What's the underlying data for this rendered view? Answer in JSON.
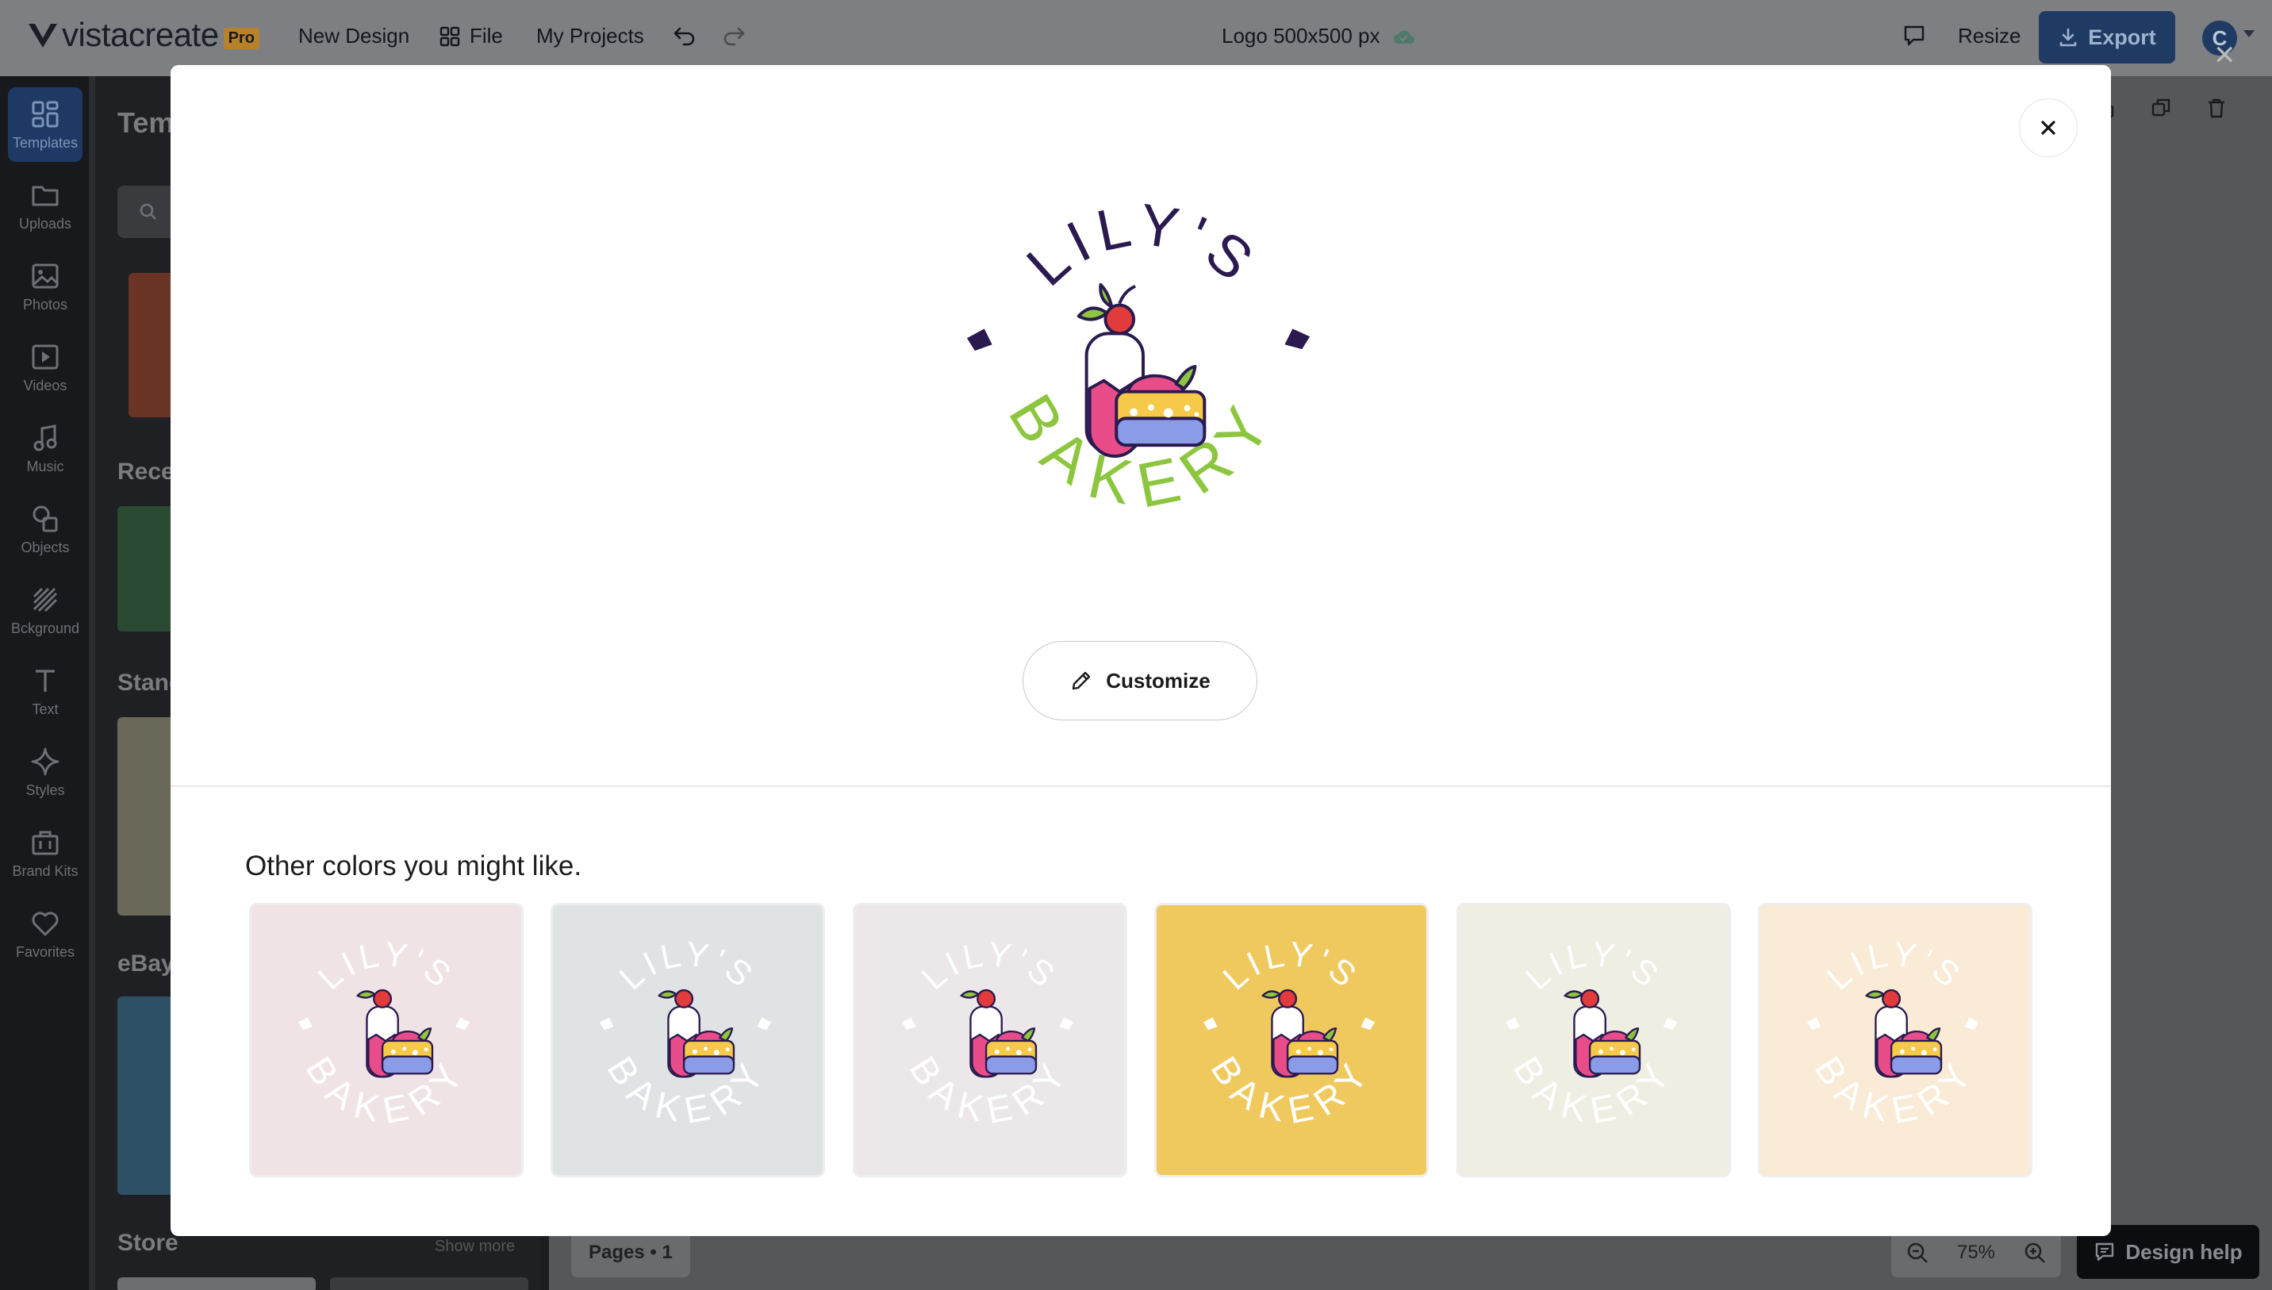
{
  "app": {
    "brand": "vistacreate",
    "badge": "Pro",
    "menu": {
      "new_design": "New Design",
      "file": "File",
      "my_projects": "My Projects"
    },
    "doc_title": "Logo 500x500 px",
    "resize": "Resize",
    "export": "Export",
    "avatar_initial": "C"
  },
  "rail": {
    "items": [
      {
        "label": "Templates",
        "icon": "templates-icon",
        "active": true
      },
      {
        "label": "Uploads",
        "icon": "folder-icon"
      },
      {
        "label": "Photos",
        "icon": "image-icon"
      },
      {
        "label": "Videos",
        "icon": "video-icon"
      },
      {
        "label": "Music",
        "icon": "music-icon"
      },
      {
        "label": "Objects",
        "icon": "shapes-icon"
      },
      {
        "label": "Bckground",
        "icon": "background-icon"
      },
      {
        "label": "Text",
        "icon": "text-icon"
      },
      {
        "label": "Styles",
        "icon": "sparkle-icon"
      },
      {
        "label": "Brand Kits",
        "icon": "briefcase-icon"
      },
      {
        "label": "Favorites",
        "icon": "heart-icon"
      }
    ]
  },
  "panel": {
    "title": "Temp",
    "sections": {
      "recent": "Recen",
      "standard": "Stand",
      "ebay": "eBay",
      "store": "Store"
    },
    "show_more": "Show more"
  },
  "canvas": {
    "pages": "Pages • 1",
    "zoom": "75%",
    "design_help": "Design help"
  },
  "modal": {
    "logo_text_top": "LILY'S",
    "logo_text_bottom": "BAKERY",
    "customize": "Customize",
    "other_title": "Other colors you might like.",
    "variants": [
      {
        "bg": "#efe3e6"
      },
      {
        "bg": "#dfe3e4"
      },
      {
        "bg": "#ece8e9"
      },
      {
        "bg": "#f0c95e"
      },
      {
        "bg": "#eeeee2"
      },
      {
        "bg": "#f9ebd6"
      }
    ]
  },
  "colors": {
    "purple": "#2a1a4f",
    "green": "#8cc63f",
    "pink": "#e84d8a",
    "yellow": "#f7c948",
    "periwinkle": "#8a9be8",
    "red": "#e23b3b",
    "accent_blue": "#1f3a63"
  }
}
